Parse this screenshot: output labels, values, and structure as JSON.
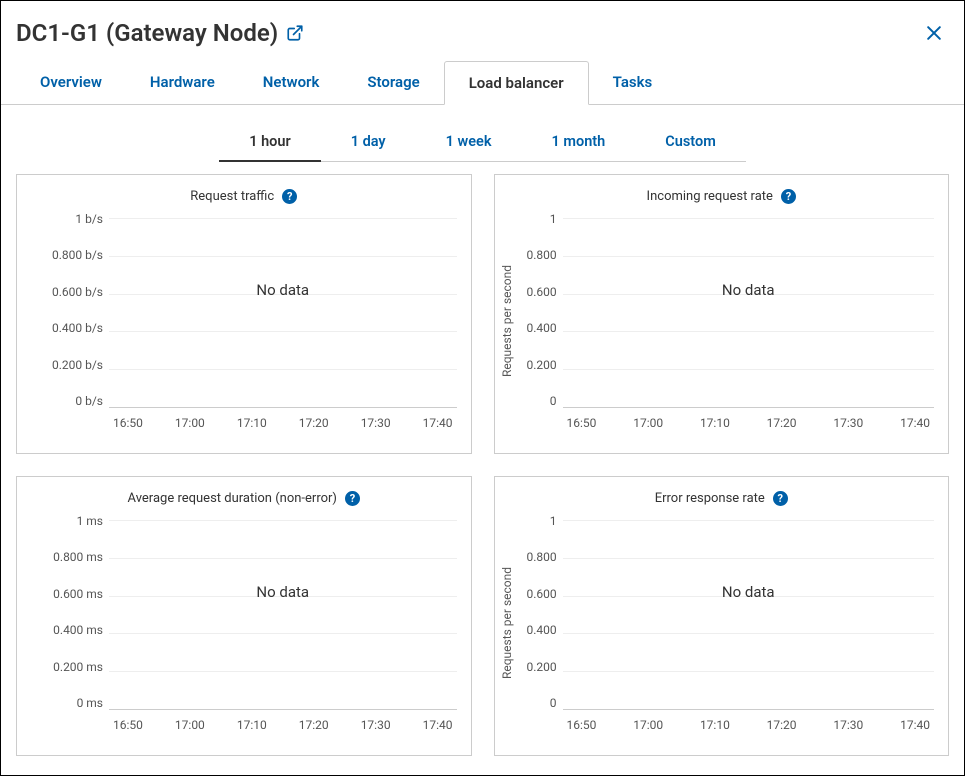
{
  "header": {
    "title": "DC1-G1 (Gateway Node)"
  },
  "tabs": [
    {
      "label": "Overview"
    },
    {
      "label": "Hardware"
    },
    {
      "label": "Network"
    },
    {
      "label": "Storage"
    },
    {
      "label": "Load balancer",
      "active": true
    },
    {
      "label": "Tasks"
    }
  ],
  "ranges": [
    {
      "label": "1 hour",
      "active": true
    },
    {
      "label": "1 day"
    },
    {
      "label": "1 week"
    },
    {
      "label": "1 month"
    },
    {
      "label": "Custom"
    }
  ],
  "charts": [
    {
      "title": "Request traffic",
      "y_label": "",
      "y_ticks": [
        "1 b/s",
        "0.800 b/s",
        "0.600 b/s",
        "0.400 b/s",
        "0.200 b/s",
        "0 b/s"
      ],
      "x_ticks": [
        "16:50",
        "17:00",
        "17:10",
        "17:20",
        "17:30",
        "17:40"
      ],
      "no_data": "No data"
    },
    {
      "title": "Incoming request rate",
      "y_label": "Requests per second",
      "y_ticks": [
        "1",
        "0.800",
        "0.600",
        "0.400",
        "0.200",
        "0"
      ],
      "x_ticks": [
        "16:50",
        "17:00",
        "17:10",
        "17:20",
        "17:30",
        "17:40"
      ],
      "no_data": "No data"
    },
    {
      "title": "Average request duration (non-error)",
      "y_label": "",
      "y_ticks": [
        "1 ms",
        "0.800 ms",
        "0.600 ms",
        "0.400 ms",
        "0.200 ms",
        "0 ms"
      ],
      "x_ticks": [
        "16:50",
        "17:00",
        "17:10",
        "17:20",
        "17:30",
        "17:40"
      ],
      "no_data": "No data"
    },
    {
      "title": "Error response rate",
      "y_label": "Requests per second",
      "y_ticks": [
        "1",
        "0.800",
        "0.600",
        "0.400",
        "0.200",
        "0"
      ],
      "x_ticks": [
        "16:50",
        "17:00",
        "17:10",
        "17:20",
        "17:30",
        "17:40"
      ],
      "no_data": "No data"
    }
  ],
  "chart_data": [
    {
      "type": "line",
      "title": "Request traffic",
      "xlabel": "",
      "ylabel": "",
      "ylim": [
        0,
        1
      ],
      "x": [],
      "values": [],
      "y_unit": "b/s",
      "x_ticks": [
        "16:50",
        "17:00",
        "17:10",
        "17:20",
        "17:30",
        "17:40"
      ]
    },
    {
      "type": "line",
      "title": "Incoming request rate",
      "xlabel": "",
      "ylabel": "Requests per second",
      "ylim": [
        0,
        1
      ],
      "x": [],
      "values": [],
      "x_ticks": [
        "16:50",
        "17:00",
        "17:10",
        "17:20",
        "17:30",
        "17:40"
      ]
    },
    {
      "type": "line",
      "title": "Average request duration (non-error)",
      "xlabel": "",
      "ylabel": "",
      "ylim": [
        0,
        1
      ],
      "x": [],
      "values": [],
      "y_unit": "ms",
      "x_ticks": [
        "16:50",
        "17:00",
        "17:10",
        "17:20",
        "17:30",
        "17:40"
      ]
    },
    {
      "type": "line",
      "title": "Error response rate",
      "xlabel": "",
      "ylabel": "Requests per second",
      "ylim": [
        0,
        1
      ],
      "x": [],
      "values": [],
      "x_ticks": [
        "16:50",
        "17:00",
        "17:10",
        "17:20",
        "17:30",
        "17:40"
      ]
    }
  ]
}
